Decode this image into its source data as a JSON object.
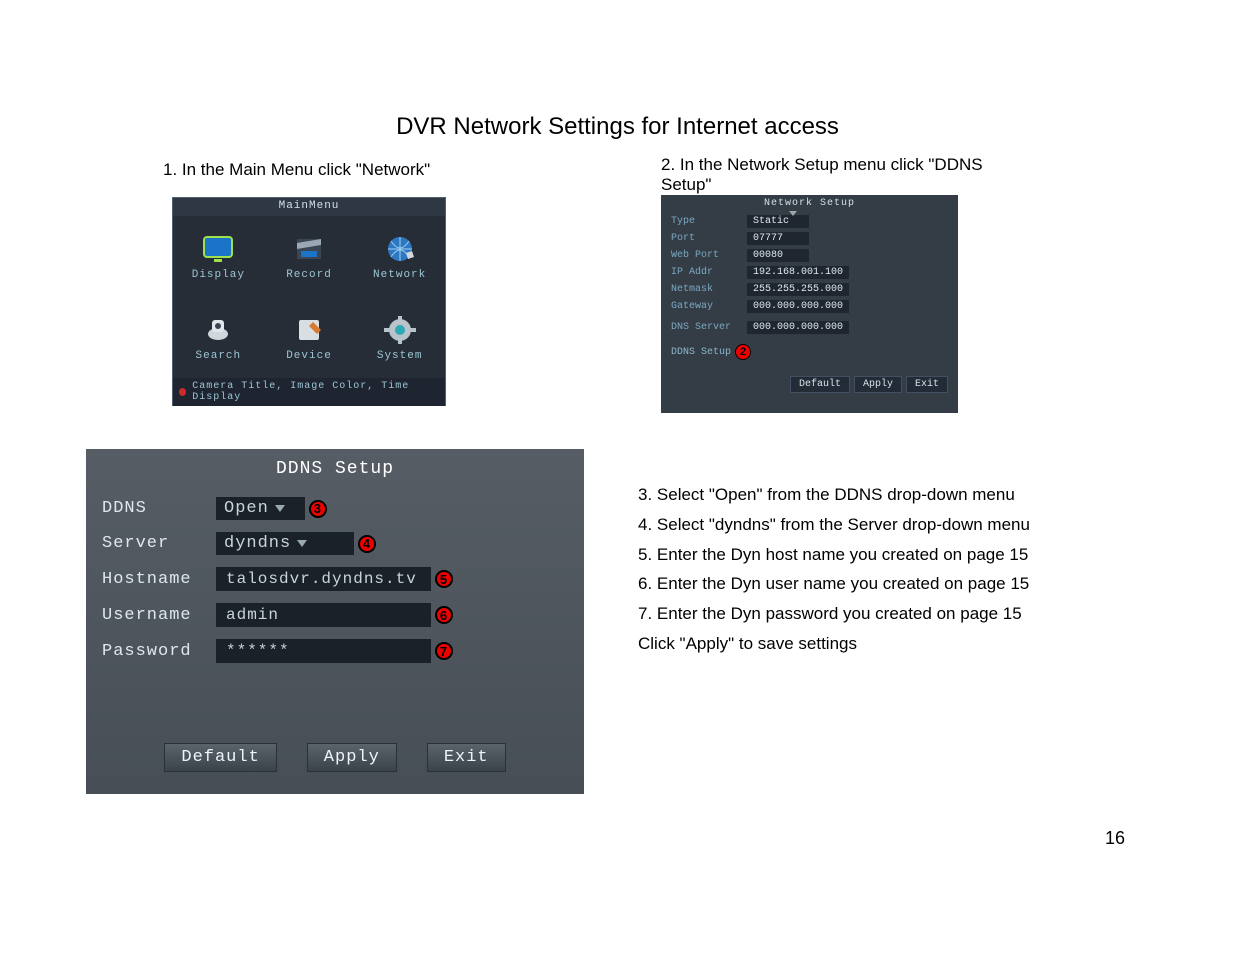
{
  "page_title": "DVR Network Settings for Internet access",
  "page_number": "16",
  "step1_caption": "1. In the Main Menu click \"Network\"",
  "step2_caption": "2. In the Network Setup menu click \"DDNS Setup\"",
  "mainmenu": {
    "title": "MainMenu",
    "items": [
      {
        "label": "Display"
      },
      {
        "label": "Record"
      },
      {
        "label": "Network"
      },
      {
        "label": "Search"
      },
      {
        "label": "Device"
      },
      {
        "label": "System"
      }
    ],
    "status_line": "Camera Title, Image Color, Time Display"
  },
  "network_setup": {
    "title": "Network Setup",
    "rows": {
      "type_label": "Type",
      "type_value": "Static",
      "port_label": "Port",
      "port_value": "07777",
      "webport_label": "Web Port",
      "webport_value": "00080",
      "ip_label": "IP Addr",
      "ip_value": "192.168.001.100",
      "netmask_label": "Netmask",
      "netmask_value": "255.255.255.000",
      "gateway_label": "Gateway",
      "gateway_value": "000.000.000.000",
      "dns_label": "DNS Server",
      "dns_value": "000.000.000.000",
      "ddns_label": "DDNS Setup"
    },
    "buttons": {
      "default": "Default",
      "apply": "Apply",
      "exit": "Exit"
    },
    "badge": "2"
  },
  "ddns_setup": {
    "title": "DDNS Setup",
    "rows": {
      "ddns_label": "DDNS",
      "ddns_value": "Open",
      "server_label": "Server",
      "server_value": "dyndns",
      "hostname_label": "Hostname",
      "hostname_value": "talosdvr.dyndns.tv",
      "username_label": "Username",
      "username_value": "admin",
      "password_label": "Password",
      "password_value": "******"
    },
    "buttons": {
      "default": "Default",
      "apply": "Apply",
      "exit": "Exit"
    },
    "badges": {
      "ddns": "3",
      "server": "4",
      "hostname": "5",
      "username": "6",
      "password": "7"
    }
  },
  "instructions": {
    "i3": "3. Select \"Open\" from the DDNS drop-down menu",
    "i4": "4. Select \"dyndns\" from the Server drop-down menu",
    "i5": "5. Enter the Dyn host name you created on page 15",
    "i6": "6. Enter the Dyn user name you created on page 15",
    "i7": "7. Enter the Dyn password you created on page 15",
    "iclick": "Click \"Apply\" to save settings"
  }
}
